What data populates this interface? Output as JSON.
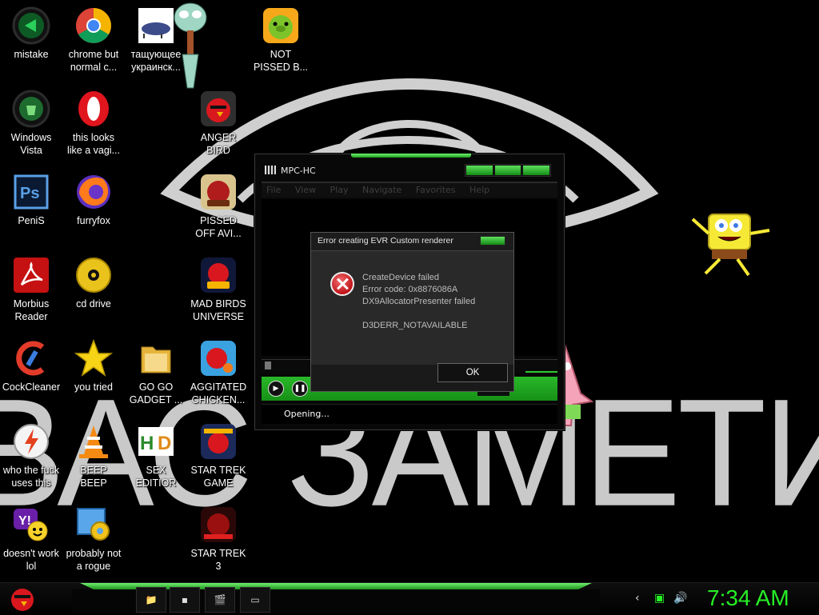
{
  "background_text": "ВАС ЗАМЕТИЛИ",
  "desktop": {
    "col1": [
      {
        "label": "mistake",
        "icon": "green-arrow-icon"
      },
      {
        "label": "Windows\nVista",
        "icon": "recycle-bin-icon"
      },
      {
        "label": "PeniS",
        "icon": "photoshop-icon"
      },
      {
        "label": "Morbius\nReader",
        "icon": "pdf-reader-icon"
      },
      {
        "label": "CockCleaner",
        "icon": "ccleaner-icon"
      },
      {
        "label": "who the fuck\nuses this",
        "icon": "flash-icon"
      },
      {
        "label": "doesn't work\nlol",
        "icon": "yahoo-messenger-icon"
      }
    ],
    "col2": [
      {
        "label": "chrome but\nnormal c...",
        "icon": "chrome-icon"
      },
      {
        "label": "this looks\nlike a vagi...",
        "icon": "opera-icon"
      },
      {
        "label": "furryfox",
        "icon": "firefox-icon"
      },
      {
        "label": "cd drive",
        "icon": "cd-drive-icon"
      },
      {
        "label": "you tried",
        "icon": "star-icon"
      },
      {
        "label": "BEEP\nBEEP",
        "icon": "vlc-cone-icon"
      },
      {
        "label": "probably not\na rogue",
        "icon": "control-panel-icon"
      }
    ],
    "col3": [
      {
        "label": "тащующее\nукраинск...",
        "icon": "fish-image-icon"
      },
      {
        "label": "GO GO\nGADGET ...",
        "icon": "folder-icon"
      },
      {
        "label": "SEX\nEDITIOR",
        "icon": "hxd-icon"
      }
    ],
    "col4": [
      {
        "label": "ANGER\nBIRD",
        "icon": "angry-bird-icon"
      },
      {
        "label": "PISSED\nOFF AVI...",
        "icon": "angry-birds-seasons-icon"
      },
      {
        "label": "MAD BIRDS\nUNIVERSE",
        "icon": "angry-birds-space-icon"
      },
      {
        "label": "AGGITATED\nCHICKEN...",
        "icon": "angry-birds-rio-icon"
      },
      {
        "label": "STAR TREK\nGAME",
        "icon": "angry-birds-star-wars-icon"
      },
      {
        "label": "STAR TREK\n3",
        "icon": "angry-birds-star-wars-2-icon"
      }
    ],
    "col5": [
      {
        "label": "NOT\nPISSED B...",
        "icon": "bad-piggies-icon"
      }
    ]
  },
  "mpc": {
    "title": "MPC-HC",
    "menu": [
      "File",
      "View",
      "Play",
      "Navigate",
      "Favorites",
      "Help"
    ],
    "status": "Opening..."
  },
  "dialog": {
    "title": "Error creating EVR Custom renderer",
    "lines": [
      "CreateDevice failed",
      "Error code: 0x8876086A",
      "DX9AllocatorPresenter failed",
      "",
      "D3DERR_NOTAVAILABLE"
    ],
    "ok": "OK"
  },
  "taskbar": {
    "clock": "7:34 AM",
    "accent": "#26f026"
  }
}
